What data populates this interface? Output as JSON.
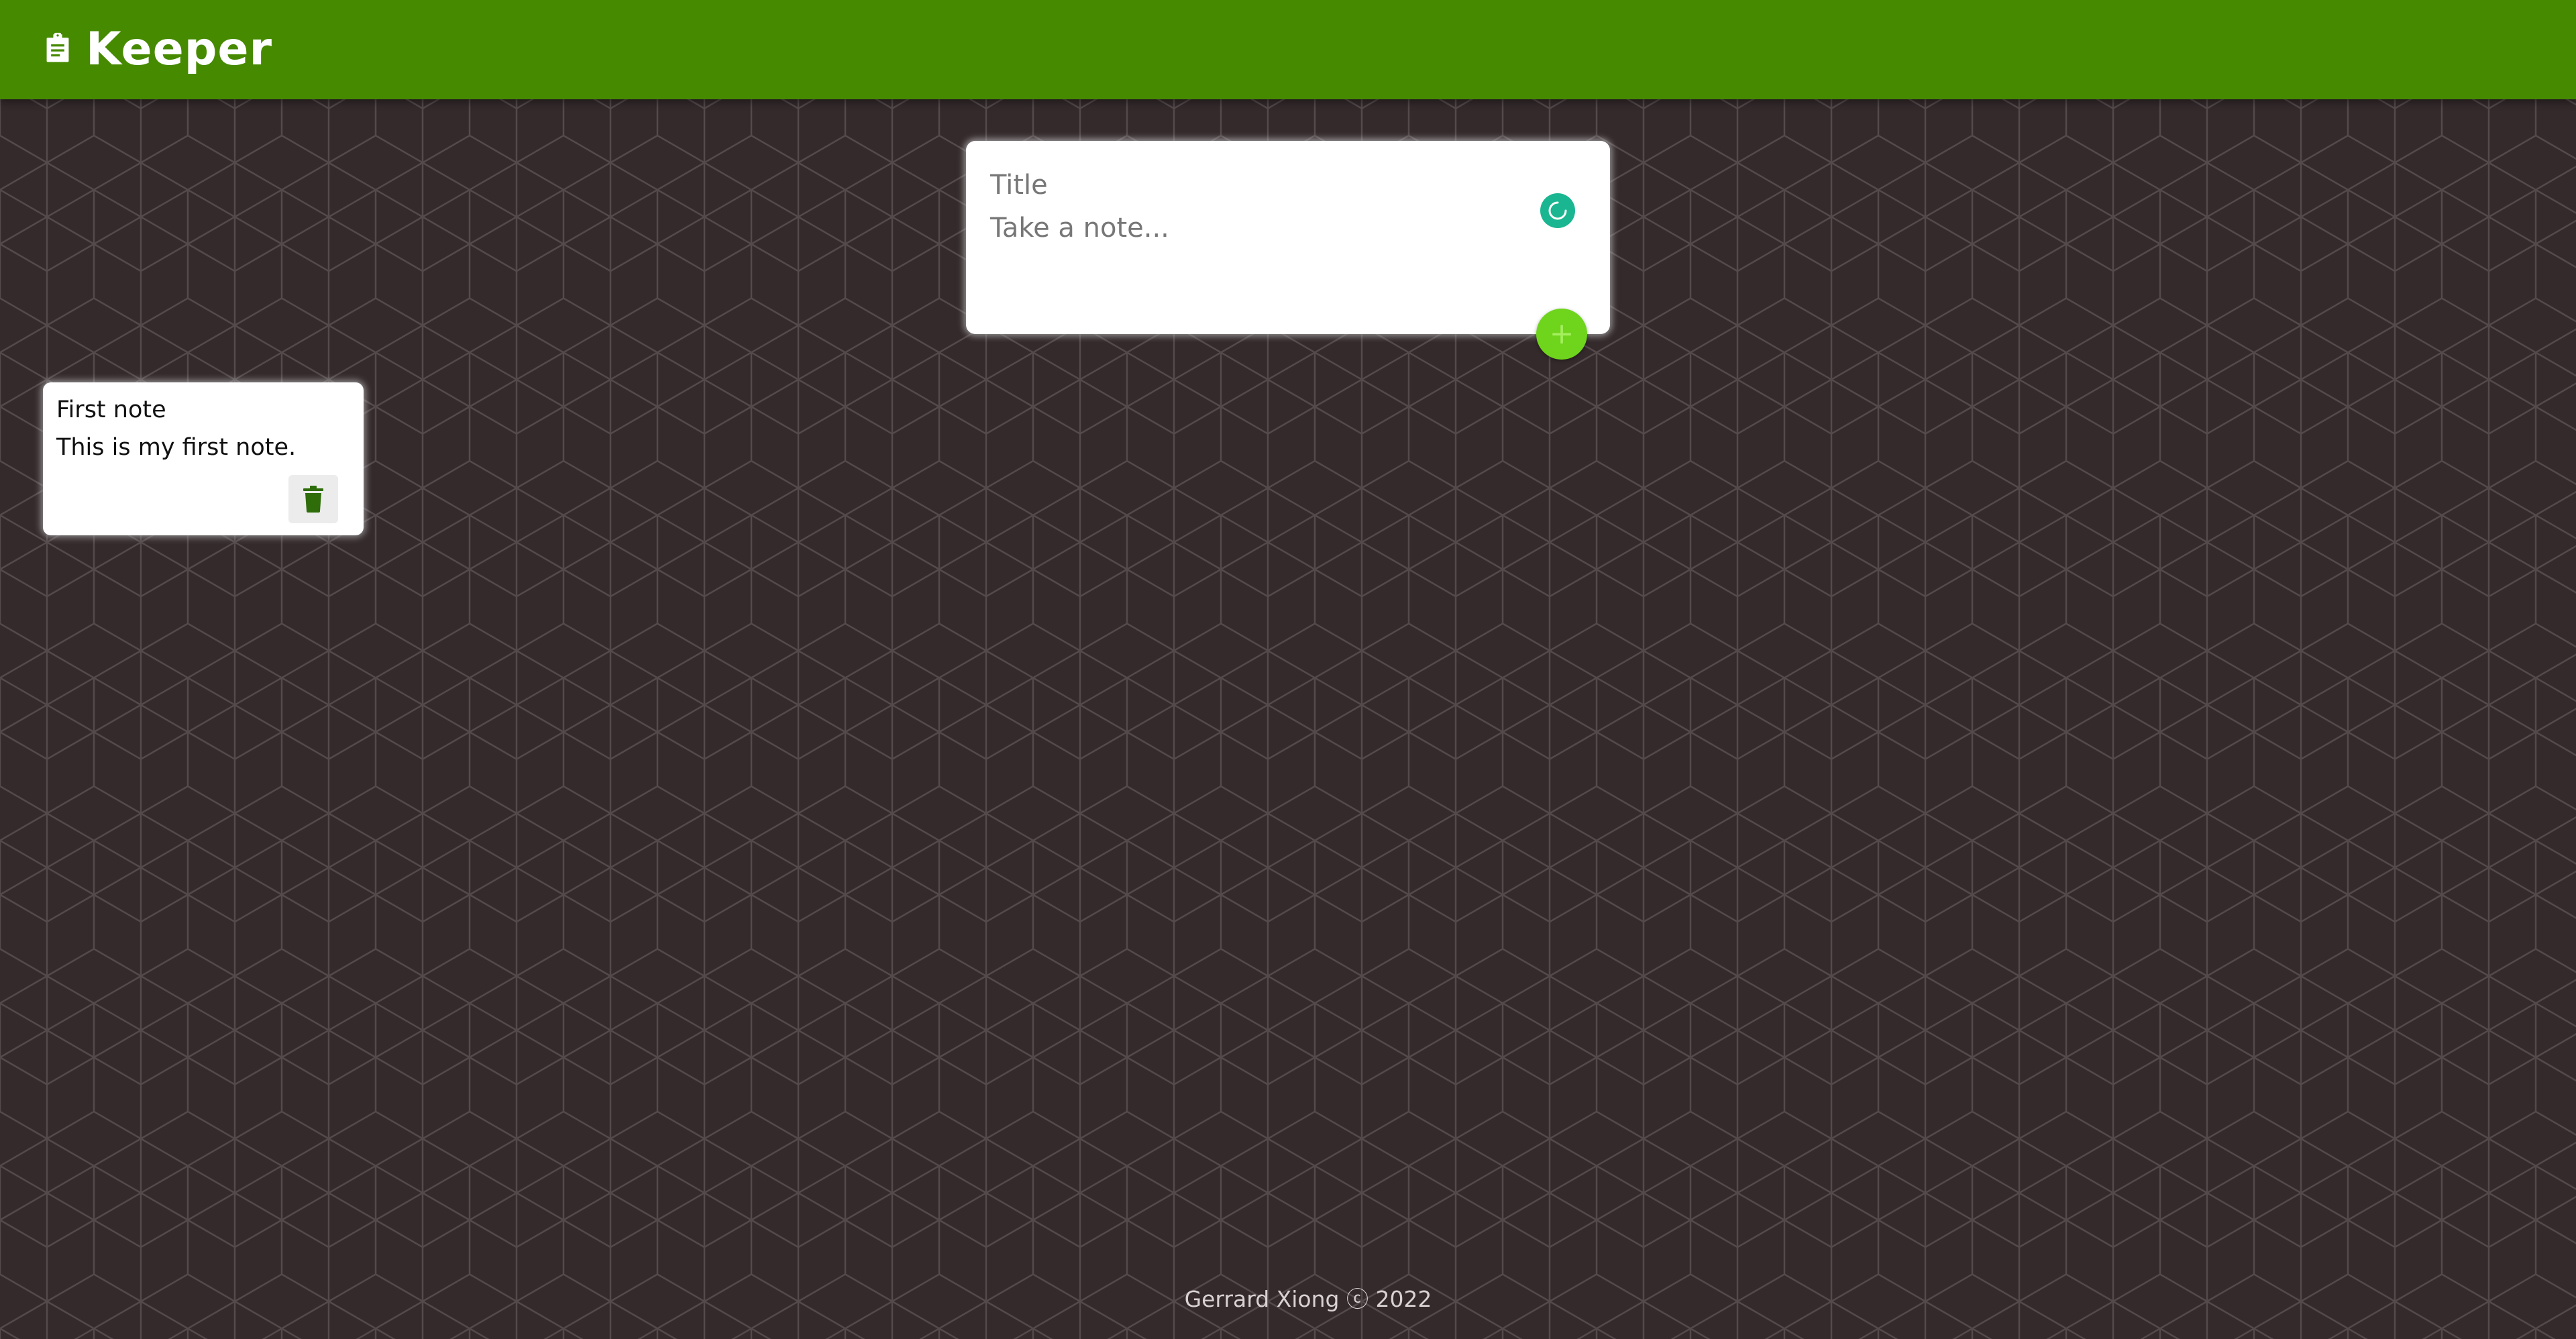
{
  "header": {
    "app_title": "Keeper",
    "logo_icon": "clipboard-icon",
    "bg_color": "#468a00"
  },
  "create_note": {
    "title_placeholder": "Title",
    "content_placeholder": "Take a note...",
    "add_icon": "plus-icon",
    "add_button_color": "#6fd41c",
    "loading_icon": "spinner-icon",
    "loading_color": "#1ab691"
  },
  "notes": [
    {
      "title": "First note",
      "content": "This is my first note.",
      "delete_icon": "trash-icon"
    }
  ],
  "footer": {
    "text": "Gerrard Xiong ⓒ 2022"
  },
  "theme": {
    "background": "#342a2c",
    "pattern_stroke": "#544a4c"
  }
}
